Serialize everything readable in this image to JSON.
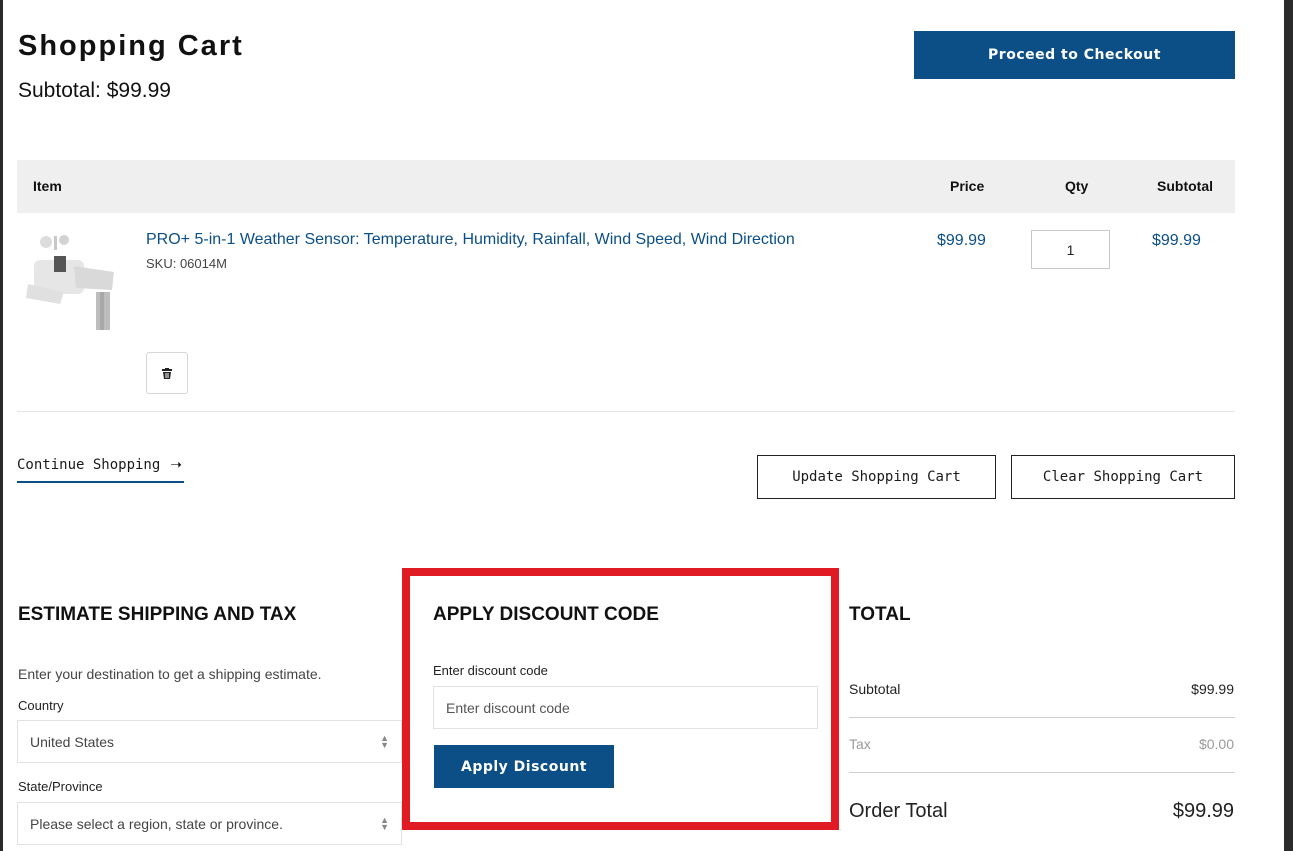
{
  "header": {
    "title": "Shopping Cart",
    "subtotal": "Subtotal: $99.99",
    "checkout_label": "Proceed to Checkout"
  },
  "table": {
    "columns": {
      "item": "Item",
      "price": "Price",
      "qty": "Qty",
      "subtotal": "Subtotal"
    },
    "rows": [
      {
        "name": "PRO+ 5-in-1 Weather Sensor: Temperature, Humidity, Rainfall, Wind Speed, Wind Direction",
        "sku": "SKU: 06014M",
        "price": "$99.99",
        "qty": "1",
        "subtotal": "$99.99"
      }
    ]
  },
  "actions": {
    "continue_label": "Continue Shopping",
    "update_label": "Update Shopping Cart",
    "clear_label": "Clear Shopping Cart"
  },
  "shipping": {
    "title": "ESTIMATE SHIPPING AND TAX",
    "intro": "Enter your destination to get a shipping estimate.",
    "country_label": "Country",
    "country_value": "United States",
    "state_label": "State/Province",
    "state_value": "Please select a region, state or province."
  },
  "discount": {
    "title": "APPLY DISCOUNT CODE",
    "label": "Enter discount code",
    "placeholder": "Enter discount code",
    "button_label": "Apply Discount"
  },
  "totals": {
    "title": "TOTAL",
    "subtotal_label": "Subtotal",
    "subtotal_value": "$99.99",
    "tax_label": "Tax",
    "tax_value": "$0.00",
    "order_total_label": "Order Total",
    "order_total_value": "$99.99"
  },
  "icons": {
    "trash": "trash-icon",
    "arrow": "arrow-right-icon",
    "select_caret": "select-caret-icon"
  },
  "colors": {
    "brand": "#0b4f86",
    "highlight": "#e01b24",
    "header_bg": "#efefef"
  }
}
